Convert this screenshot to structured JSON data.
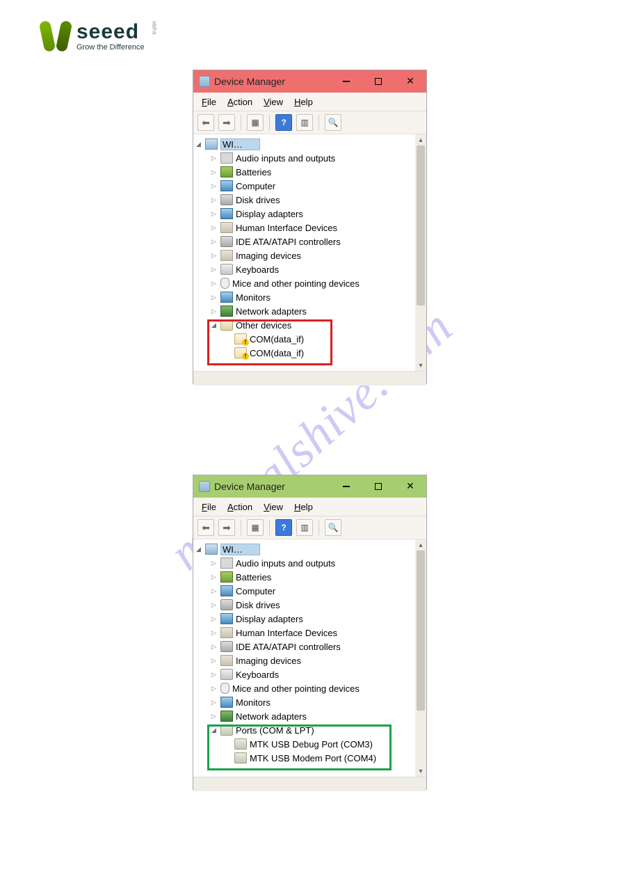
{
  "logo": {
    "brand": "seeed",
    "tag": "Grow the Difference",
    "alpha": "alpha"
  },
  "watermark": "manualshive.com",
  "dm": {
    "title": "Device Manager",
    "menus": {
      "file": "File",
      "action": "Action",
      "view": "View",
      "help": "Help"
    },
    "root": "WI…",
    "common": [
      "Audio inputs and outputs",
      "Batteries",
      "Computer",
      "Disk drives",
      "Display adapters",
      "Human Interface Devices",
      "IDE ATA/ATAPI controllers",
      "Imaging devices",
      "Keyboards",
      "Mice and other pointing devices",
      "Monitors",
      "Network adapters"
    ],
    "win1": {
      "category": "Other devices",
      "items": [
        "COM(data_if)",
        "COM(data_if)"
      ]
    },
    "win2": {
      "category": "Ports (COM & LPT)",
      "items": [
        "MTK USB Debug Port (COM3)",
        "MTK USB Modem Port (COM4)"
      ]
    }
  }
}
